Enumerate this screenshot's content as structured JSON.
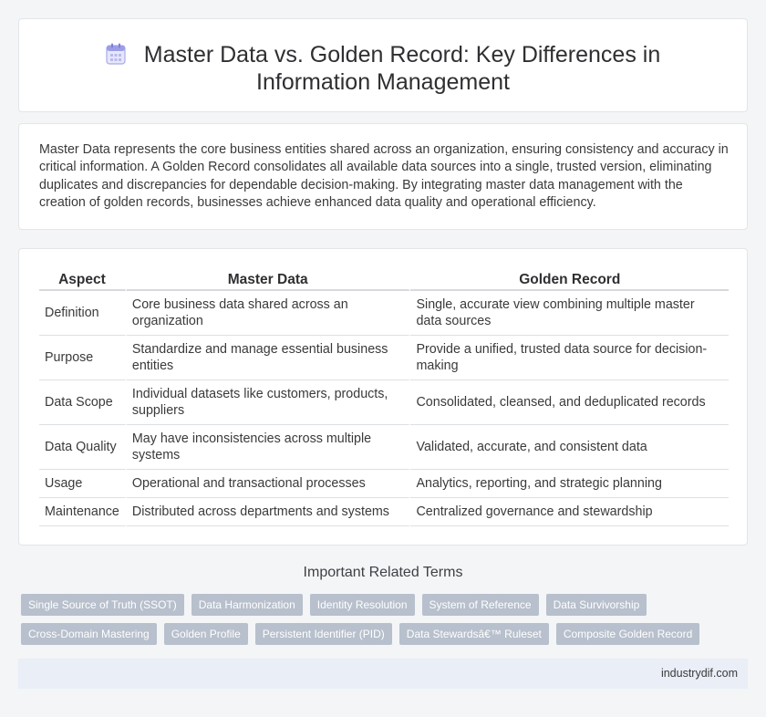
{
  "header": {
    "icon": "calendar-icon",
    "title": "Master Data vs. Golden Record: Key Differences in Information Management"
  },
  "intro": {
    "text": "Master Data represents the core business entities shared across an organization, ensuring consistency and accuracy in critical information. A Golden Record consolidates all available data sources into a single, trusted version, eliminating duplicates and discrepancies for dependable decision-making. By integrating master data management with the creation of golden records, businesses achieve enhanced data quality and operational efficiency."
  },
  "table": {
    "headers": [
      "Aspect",
      "Master Data",
      "Golden Record"
    ],
    "rows": [
      [
        "Definition",
        "Core business data shared across an organization",
        "Single, accurate view combining multiple master data sources"
      ],
      [
        "Purpose",
        "Standardize and manage essential business entities",
        "Provide a unified, trusted data source for decision-making"
      ],
      [
        "Data Scope",
        "Individual datasets like customers, products, suppliers",
        "Consolidated, cleansed, and deduplicated records"
      ],
      [
        "Data Quality",
        "May have inconsistencies across multiple systems",
        "Validated, accurate, and consistent data"
      ],
      [
        "Usage",
        "Operational and transactional processes",
        "Analytics, reporting, and strategic planning"
      ],
      [
        "Maintenance",
        "Distributed across departments and systems",
        "Centralized governance and stewardship"
      ]
    ]
  },
  "related": {
    "heading": "Important Related Terms",
    "tags": [
      "Single Source of Truth (SSOT)",
      "Data Harmonization",
      "Identity Resolution",
      "System of Reference",
      "Data Survivorship",
      "Cross-Domain Mastering",
      "Golden Profile",
      "Persistent Identifier (PID)",
      "Data Stewardsâ€™ Ruleset",
      "Composite Golden Record"
    ]
  },
  "footer": {
    "site": "industrydif.com"
  },
  "colors": {
    "tag_bg": "#b7c0cc",
    "footer_bg": "#e9eef7",
    "icon_accent": "#8f8fe0"
  }
}
